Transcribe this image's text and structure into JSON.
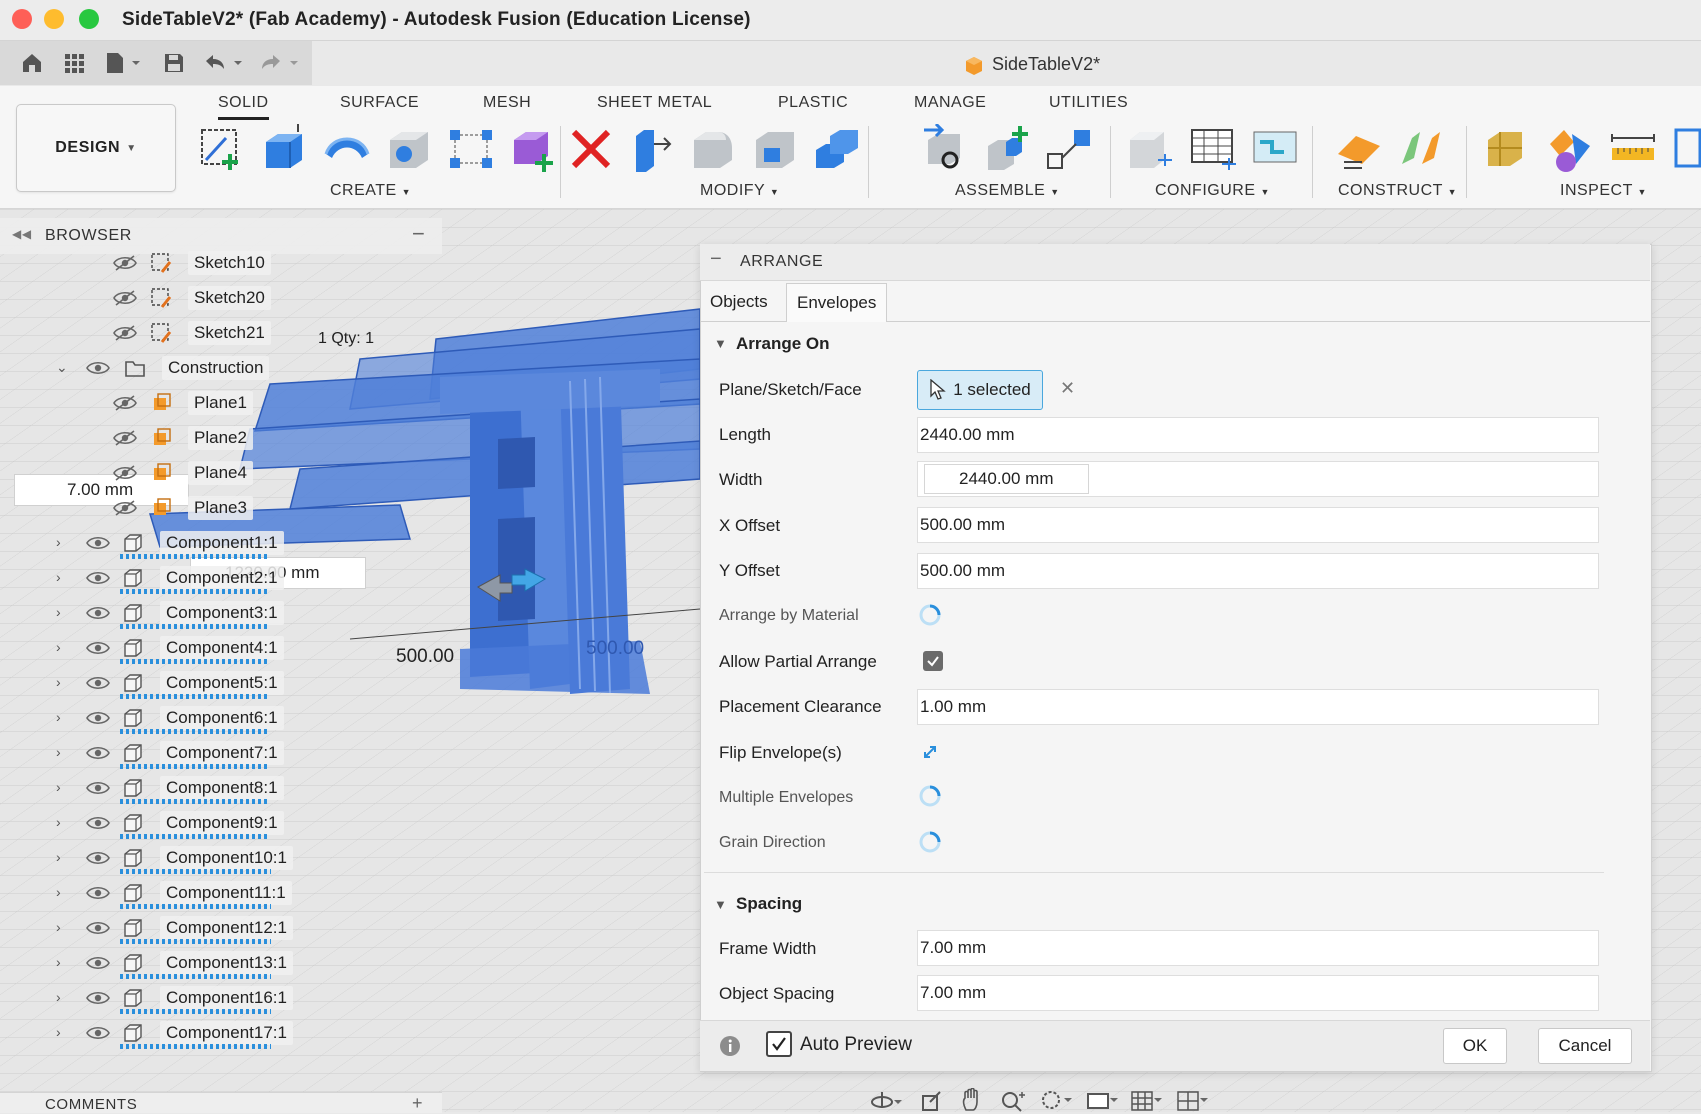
{
  "window": {
    "title": "SideTableV2* (Fab Academy) - Autodesk Fusion (Education License)",
    "doc_tab": "SideTableV2*"
  },
  "workspace": {
    "label": "DESIGN"
  },
  "ribbon": {
    "tabs": [
      "SOLID",
      "SURFACE",
      "MESH",
      "SHEET METAL",
      "PLASTIC",
      "MANAGE",
      "UTILITIES"
    ],
    "active_tab": "SOLID",
    "groups": [
      "CREATE",
      "MODIFY",
      "ASSEMBLE",
      "CONFIGURE",
      "CONSTRUCT",
      "INSPECT"
    ]
  },
  "browser": {
    "title": "BROWSER",
    "items": [
      "Sketch10",
      "Sketch20",
      "Sketch21",
      "Construction",
      "Plane1",
      "Plane2",
      "Plane4",
      "Plane3",
      "Component1:1",
      "Component2:1",
      "Component3:1",
      "Component4:1",
      "Component5:1",
      "Component6:1",
      "Component7:1",
      "Component8:1",
      "Component9:1",
      "Component10:1",
      "Component11:1",
      "Component12:1",
      "Component13:1",
      "Component16:1",
      "Component17:1"
    ],
    "comments_label": "COMMENTS"
  },
  "viewport": {
    "qty_label": "1 Qty: 1",
    "float_frame_width": "7.00 mm",
    "float_length": "1220.00 mm",
    "dim_left": "500.00",
    "dim_right": "500.00"
  },
  "arrange": {
    "title": "ARRANGE",
    "tabs": [
      "Objects",
      "Envelopes"
    ],
    "active_tab": "Envelopes",
    "section_arrange_on": "Arrange On",
    "section_spacing": "Spacing",
    "fields": {
      "plane_label": "Plane/Sketch/Face",
      "plane_value": "1 selected",
      "length_label": "Length",
      "length_value": "2440.00 mm",
      "width_label": "Width",
      "width_value": "2440.00 mm",
      "xoffset_label": "X Offset",
      "xoffset_value": "500.00 mm",
      "yoffset_label": "Y Offset",
      "yoffset_value": "500.00 mm",
      "by_material_label": "Arrange by Material",
      "partial_label": "Allow Partial Arrange",
      "partial_checked": true,
      "clearance_label": "Placement Clearance",
      "clearance_value": "1.00 mm",
      "flip_label": "Flip Envelope(s)",
      "multiple_label": "Multiple Envelopes",
      "grain_label": "Grain Direction",
      "frame_width_label": "Frame Width",
      "frame_width_value": "7.00 mm",
      "object_spacing_label": "Object Spacing",
      "object_spacing_value": "7.00 mm"
    },
    "auto_preview_label": "Auto Preview",
    "auto_preview_checked": true,
    "ok_label": "OK",
    "cancel_label": "Cancel"
  },
  "colors": {
    "accent": "#2a8fdc",
    "model_blue": "#3d6fd0",
    "panel_bg": "#f5f5f5",
    "close_red": "#fe5f57",
    "minimize_yellow": "#febc2e",
    "zoom_green": "#28c840"
  }
}
